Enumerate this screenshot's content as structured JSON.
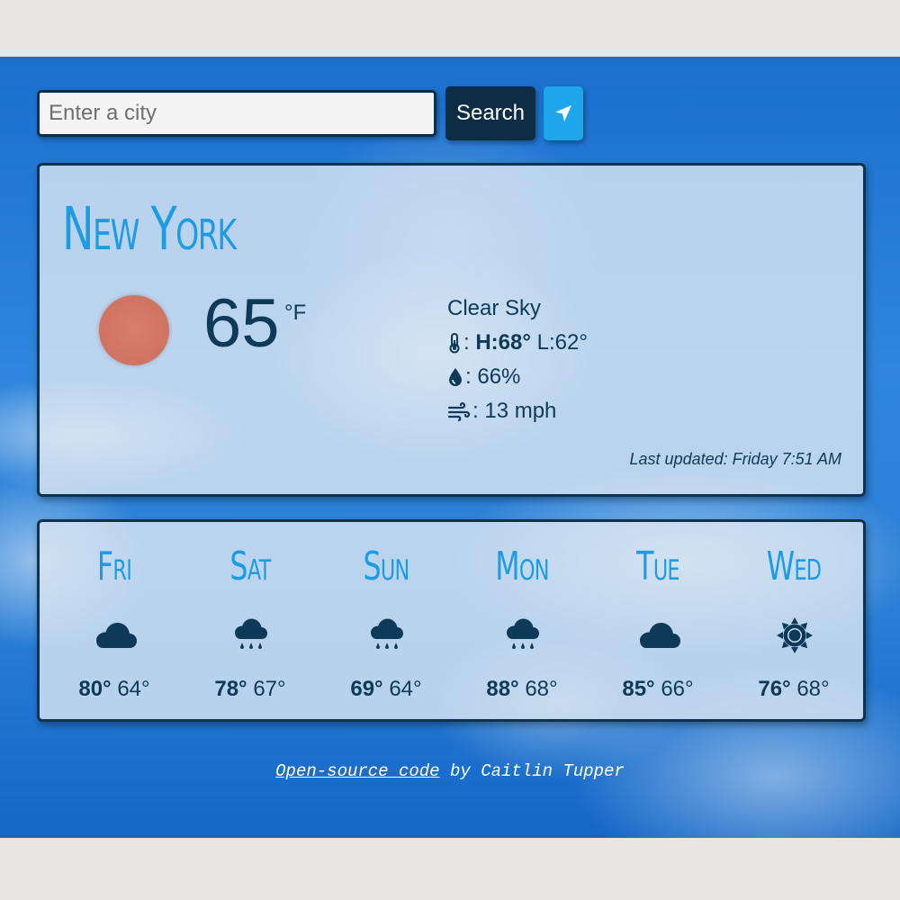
{
  "search": {
    "placeholder": "Enter a city",
    "value": "",
    "button_label": "Search",
    "location_icon": "location-arrow-icon"
  },
  "current": {
    "city": "New York",
    "temperature": "65",
    "unit": "°F",
    "description": "Clear Sky",
    "high_label": "H:68°",
    "low_label": "L:62°",
    "humidity": "66%",
    "wind": "13 mph",
    "last_updated": "Last updated: Friday 7:51 AM",
    "icon": "sun-icon",
    "colors": {
      "sun": "#d27464",
      "accent": "#1e9ce3",
      "text": "#0e3a5a"
    }
  },
  "forecast": [
    {
      "day": "Fri",
      "icon": "cloud-icon",
      "high": "80°",
      "low": "64°"
    },
    {
      "day": "Sat",
      "icon": "rain-icon",
      "high": "78°",
      "low": "67°"
    },
    {
      "day": "Sun",
      "icon": "rain-icon",
      "high": "69°",
      "low": "64°"
    },
    {
      "day": "Mon",
      "icon": "rain-icon",
      "high": "88°",
      "low": "68°"
    },
    {
      "day": "Tue",
      "icon": "cloud-icon",
      "high": "85°",
      "low": "66°"
    },
    {
      "day": "Wed",
      "icon": "sun-icon",
      "high": "76°",
      "low": "68°"
    }
  ],
  "footer": {
    "link_text": "Open-source code",
    "by_text": " by Caitlin Tupper"
  }
}
